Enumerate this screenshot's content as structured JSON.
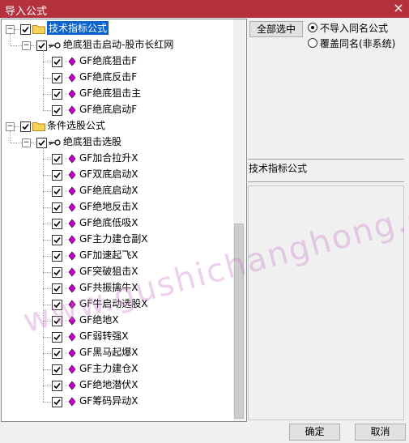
{
  "window": {
    "title": "导入公式",
    "close_icon": "×"
  },
  "tree": {
    "groups": [
      {
        "label": "技术指标公式",
        "selected": true,
        "checked": true,
        "subgroups": [
          {
            "label": "绝底狙击启动-股市长红网",
            "checked": true,
            "items": [
              "GF绝底狙击F",
              "GF绝底反击F",
              "GF绝底狙击主",
              "GF绝底启动F"
            ]
          }
        ]
      },
      {
        "label": "条件选股公式",
        "selected": false,
        "checked": true,
        "subgroups": [
          {
            "label": "绝底狙击选股",
            "checked": true,
            "items": [
              "GF加合拉升X",
              "GF双底启动X",
              "GF绝底启动X",
              "GF绝地反击X",
              "GF绝底低吸X",
              "GF主力建仓副X",
              "GF加速起飞X",
              "GF突破狙击X",
              "GF共振擒牛X",
              "GF牛启动选股X",
              "GF绝地X",
              "GF弱转强X",
              "GF黑马起爆X",
              "GF主力建仓X",
              "GF绝地潜伏X",
              "GF筹码异动X"
            ]
          }
        ]
      }
    ]
  },
  "options": {
    "select_all_label": "全部选中",
    "radio_no_import": "不导入同名公式",
    "radio_overwrite": "覆盖同名(非系统)",
    "selected_radio": "no_import"
  },
  "detail": {
    "section_label": "技术指标公式"
  },
  "buttons": {
    "ok": "确定",
    "cancel": "取消"
  },
  "watermark": "www.gushichanghong.com",
  "colors": {
    "titlebar": "#b5323d",
    "selection": "#0a64cc",
    "diamond": "#c000c0"
  }
}
